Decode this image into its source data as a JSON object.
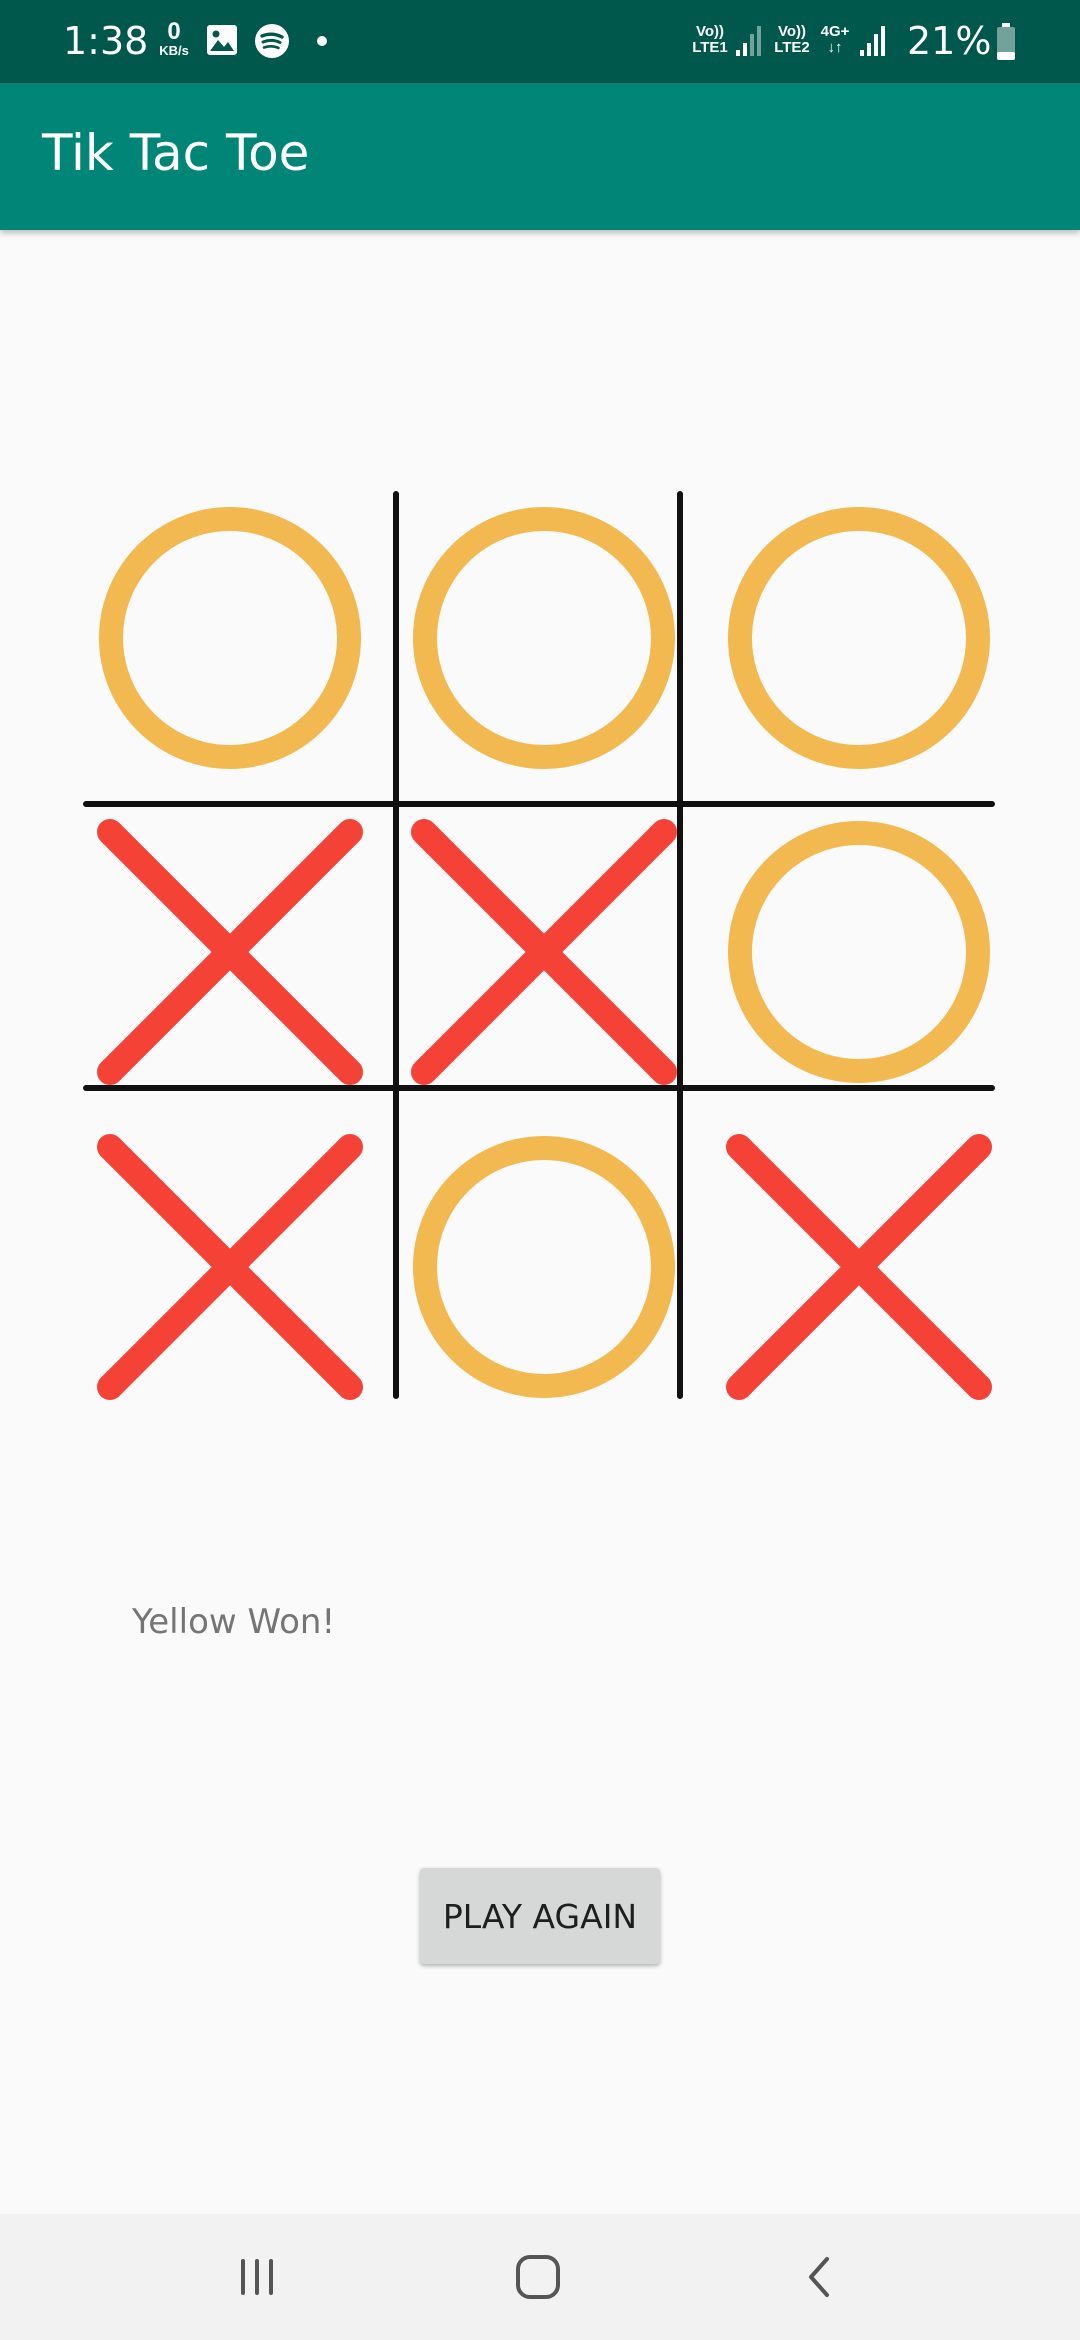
{
  "status_bar": {
    "time": "1:38",
    "net_speed_value": "0",
    "net_speed_unit": "KB/s",
    "sim1_label_top": "Vo))",
    "sim1_label_bottom": "LTE1",
    "sim2_label_top": "Vo))",
    "sim2_label_bottom": "LTE2",
    "network_type": "4G+",
    "battery_percent": "21%",
    "notification_icons": [
      "gallery-icon",
      "spotify-icon",
      "dot-icon"
    ]
  },
  "app_bar": {
    "title": "Tik Tac Toe"
  },
  "game": {
    "board": [
      [
        "O",
        "O",
        "O"
      ],
      [
        "X",
        "X",
        "O"
      ],
      [
        "X",
        "O",
        "X"
      ]
    ],
    "status_text": "Yellow Won!",
    "play_again_label": "PLAY AGAIN"
  },
  "colors": {
    "status_bar": "#00574b",
    "app_bar": "#008577",
    "o_mark": "#f2b950",
    "x_mark": "#f44236",
    "grid_line": "#111111",
    "button_bg": "#d6d7d7"
  },
  "nav_bar": {
    "icons": [
      "recent-apps-icon",
      "home-icon",
      "back-icon"
    ]
  }
}
